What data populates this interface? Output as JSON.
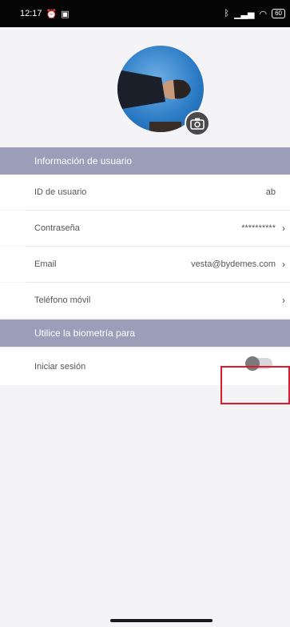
{
  "status_bar": {
    "time": "12:17",
    "battery": "60"
  },
  "section_user": {
    "header": "Información de usuario",
    "rows": [
      {
        "label": "ID de usuario",
        "value": "ab"
      },
      {
        "label": "Contraseña",
        "value": "**********"
      },
      {
        "label": "Email",
        "value": "vesta@bydemes.com"
      },
      {
        "label": "Teléfono móvil",
        "value": ""
      }
    ]
  },
  "section_bio": {
    "header": "Utilice la biometría para",
    "login_label": "Iniciar sesión",
    "toggle_on": false
  },
  "colors": {
    "section_header": "#9a9eb9",
    "highlight": "#e0192b",
    "status_bar": "#050505"
  }
}
